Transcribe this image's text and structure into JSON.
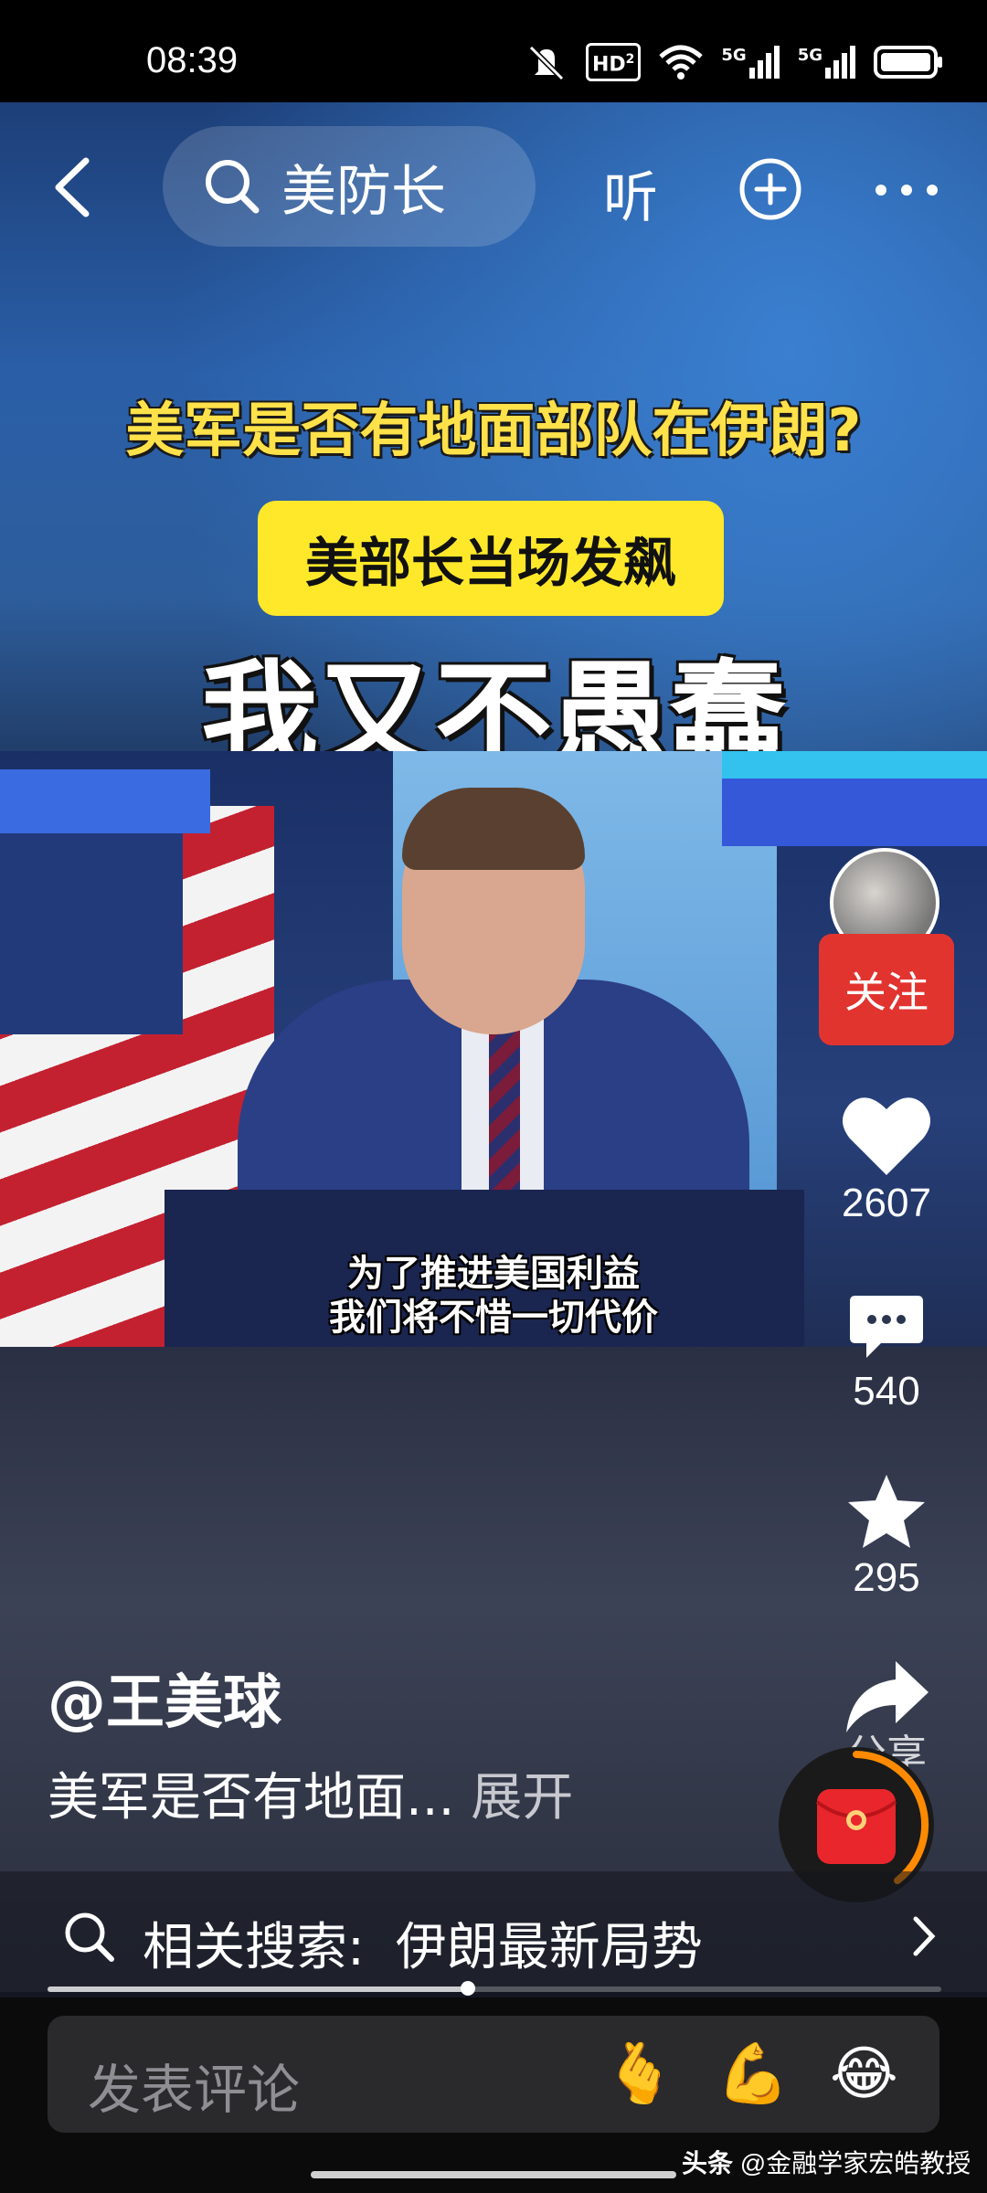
{
  "status_bar": {
    "time": "08:39",
    "icons": [
      "mute-icon",
      "hd-icon",
      "wifi-icon",
      "5g-signal-icon",
      "5g-signal-icon",
      "battery-icon"
    ],
    "hd_label": "HD",
    "network_1": "5G",
    "network_2": "5G"
  },
  "nav": {
    "search_query": "美防长",
    "listen_label": "听"
  },
  "video": {
    "headline": "美军是否有地面部队在伊朗?",
    "subhead": "美部长当场发飙",
    "big_title": "我又不愚蠢",
    "caption_line1": "为了推进美国利益",
    "caption_line2": "我们将不惜一切代价"
  },
  "actions": {
    "follow_label": "关注",
    "likes": "2607",
    "comments": "540",
    "favorites": "295",
    "share_label": "分享"
  },
  "post": {
    "author": "@王美球",
    "description": "美军是否有地面...",
    "expand_label": "展开"
  },
  "related": {
    "prefix": "相关搜索:",
    "query": "伊朗最新局势"
  },
  "progress": {
    "fraction": 0.47
  },
  "comment": {
    "placeholder": "发表评论",
    "emojis": [
      "🫰",
      "💪",
      "😂"
    ]
  },
  "watermark": {
    "brand": "头条",
    "account": "@金融学家宏皓教授"
  },
  "colors": {
    "follow_red": "#e2342f",
    "headline_yellow": "#ffe14a",
    "subhead_bg": "#ffe82a",
    "loader_orange": "#ff8a00"
  }
}
